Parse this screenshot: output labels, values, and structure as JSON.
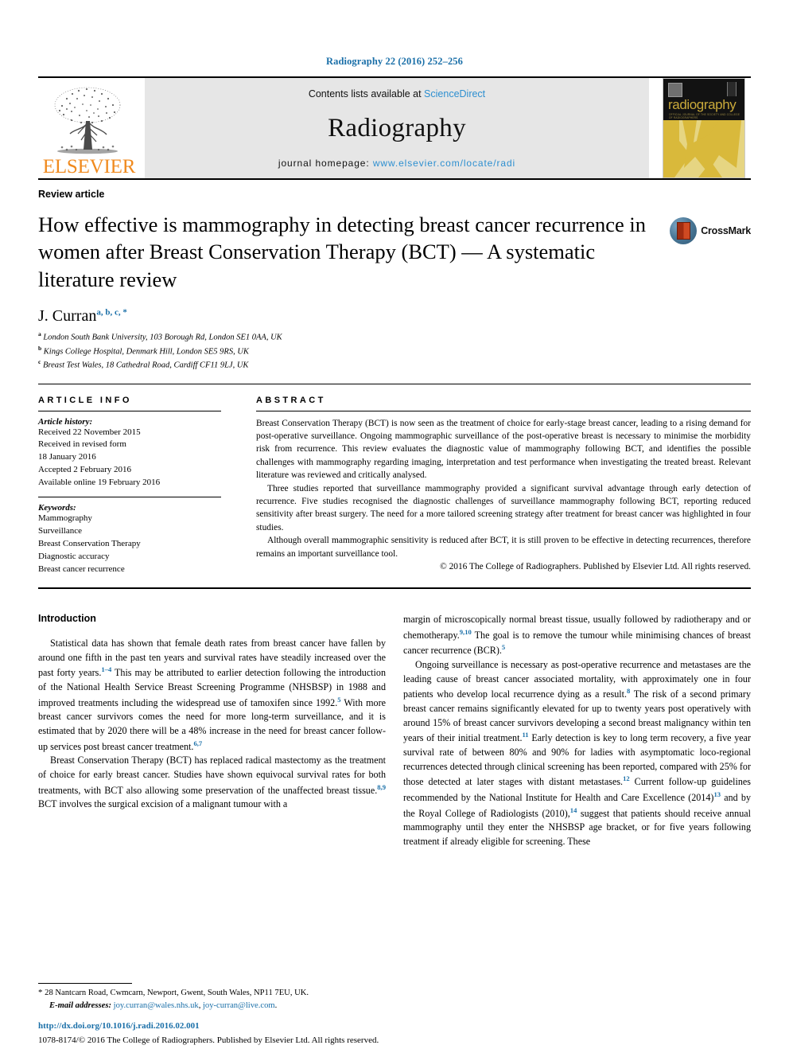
{
  "running_head": "Radiography 22 (2016) 252–256",
  "banner": {
    "publisher_name": "ELSEVIER",
    "contents_prefix": "Contents lists available at ",
    "contents_link": "ScienceDirect",
    "journal_title": "Radiography",
    "homepage_prefix": "journal homepage: ",
    "homepage_url": "www.elsevier.com/locate/radi",
    "cover_title": "radiography",
    "cover_subtitle": "OFFICIAL JOURNAL OF THE SOCIETY AND COLLEGE OF RADIOGRAPHERS"
  },
  "article": {
    "type": "Review article",
    "title": "How effective is mammography in detecting breast cancer recurrence in women after Breast Conservation Therapy (BCT) — A systematic literature review",
    "crossmark_label": "CrossMark",
    "author": "J. Curran",
    "author_marks": "a, b, c, *",
    "affiliations": [
      {
        "mark": "a",
        "text": "London South Bank University, 103 Borough Rd, London SE1 0AA, UK"
      },
      {
        "mark": "b",
        "text": "Kings College Hospital, Denmark Hill, London SE5 9RS, UK"
      },
      {
        "mark": "c",
        "text": "Breast Test Wales, 18 Cathedral Road, Cardiff CF11 9LJ, UK"
      }
    ]
  },
  "article_info": {
    "heading": "ARTICLE INFO",
    "history_title": "Article history:",
    "history": [
      "Received 22 November 2015",
      "Received in revised form",
      "18 January 2016",
      "Accepted 2 February 2016",
      "Available online 19 February 2016"
    ],
    "keywords_title": "Keywords:",
    "keywords": [
      "Mammography",
      "Surveillance",
      "Breast Conservation Therapy",
      "Diagnostic accuracy",
      "Breast cancer recurrence"
    ]
  },
  "abstract": {
    "heading": "ABSTRACT",
    "paragraphs": [
      "Breast Conservation Therapy (BCT) is now seen as the treatment of choice for early-stage breast cancer, leading to a rising demand for post-operative surveillance. Ongoing mammographic surveillance of the post-operative breast is necessary to minimise the morbidity risk from recurrence. This review evaluates the diagnostic value of mammography following BCT, and identifies the possible challenges with mammography regarding imaging, interpretation and test performance when investigating the treated breast. Relevant literature was reviewed and critically analysed.",
      "Three studies reported that surveillance mammography provided a significant survival advantage through early detection of recurrence. Five studies recognised the diagnostic challenges of surveillance mammography following BCT, reporting reduced sensitivity after breast surgery. The need for a more tailored screening strategy after treatment for breast cancer was highlighted in four studies.",
      "Although overall mammographic sensitivity is reduced after BCT, it is still proven to be effective in detecting recurrences, therefore remains an important surveillance tool."
    ],
    "copyright": "© 2016 The College of Radiographers. Published by Elsevier Ltd. All rights reserved."
  },
  "body": {
    "section_heading": "Introduction",
    "left_column": [
      {
        "runs": [
          {
            "t": "Statistical data has shown that female death rates from breast cancer have fallen by around one fifth in the past ten years and survival rates have steadily increased over the past forty years."
          },
          {
            "t": "1–4",
            "ref": true
          },
          {
            "t": " This may be attributed to earlier detection following the introduction of the National Health Service Breast Screening Programme (NHSBSP) in 1988 and improved treatments including the widespread use of tamoxifen since 1992."
          },
          {
            "t": "5",
            "ref": true
          },
          {
            "t": " With more breast cancer survivors comes the need for more long-term surveillance, and it is estimated that by 2020 there will be a 48% increase in the need for breast cancer follow-up services post breast cancer treatment."
          },
          {
            "t": "6,7",
            "ref": true
          }
        ]
      },
      {
        "runs": [
          {
            "t": "Breast Conservation Therapy (BCT) has replaced radical mastectomy as the treatment of choice for early breast cancer. Studies have shown equivocal survival rates for both treatments, with BCT also allowing some preservation of the unaffected breast tissue."
          },
          {
            "t": "8,9",
            "ref": true
          },
          {
            "t": " BCT involves the surgical excision of a malignant tumour with a"
          }
        ]
      }
    ],
    "right_column": [
      {
        "runs": [
          {
            "t": "margin of microscopically normal breast tissue, usually followed by radiotherapy and or chemotherapy."
          },
          {
            "t": "9,10",
            "ref": true
          },
          {
            "t": " The goal is to remove the tumour while minimising chances of breast cancer recurrence (BCR)."
          },
          {
            "t": "5",
            "ref": true
          }
        ],
        "no_indent": true
      },
      {
        "runs": [
          {
            "t": "Ongoing surveillance is necessary as post-operative recurrence and metastases are the leading cause of breast cancer associated mortality, with approximately one in four patients who develop local recurrence dying as a result."
          },
          {
            "t": "8",
            "ref": true
          },
          {
            "t": " The risk of a second primary breast cancer remains significantly elevated for up to twenty years post operatively with around 15% of breast cancer survivors developing a second breast malignancy within ten years of their initial treatment."
          },
          {
            "t": "11",
            "ref": true
          },
          {
            "t": " Early detection is key to long term recovery, a five year survival rate of between 80% and 90% for ladies with asymptomatic loco-regional recurrences detected through clinical screening has been reported, compared with 25% for those detected at later stages with distant metastases."
          },
          {
            "t": "12",
            "ref": true
          },
          {
            "t": " Current follow-up guidelines recommended by the National Institute for Health and Care Excellence (2014)"
          },
          {
            "t": "13",
            "ref": true
          },
          {
            "t": " and by the Royal College of Radiologists (2010),"
          },
          {
            "t": "14",
            "ref": true
          },
          {
            "t": " suggest that patients should receive annual mammography until they enter the NHSBSP age bracket, or for five years following treatment if already eligible for screening. These"
          }
        ]
      }
    ]
  },
  "footer": {
    "corresponding_star": "*",
    "corresponding_address": "28 Nantcarn Road, Cwmcarn, Newport, Gwent, South Wales, NP11 7EU, UK.",
    "email_label": "E-mail addresses:",
    "emails": [
      "joy.curran@wales.nhs.uk",
      "joy-curran@live.com"
    ],
    "doi": "http://dx.doi.org/10.1016/j.radi.2016.02.001",
    "issn_line": "1078-8174/© 2016 The College of Radiographers. Published by Elsevier Ltd. All rights reserved."
  },
  "colors": {
    "link_blue": "#1a6fa8",
    "sciencedirect_blue": "#2d8fd0",
    "elsevier_orange": "#f08a1e",
    "cover_gold": "#d9b93b"
  }
}
